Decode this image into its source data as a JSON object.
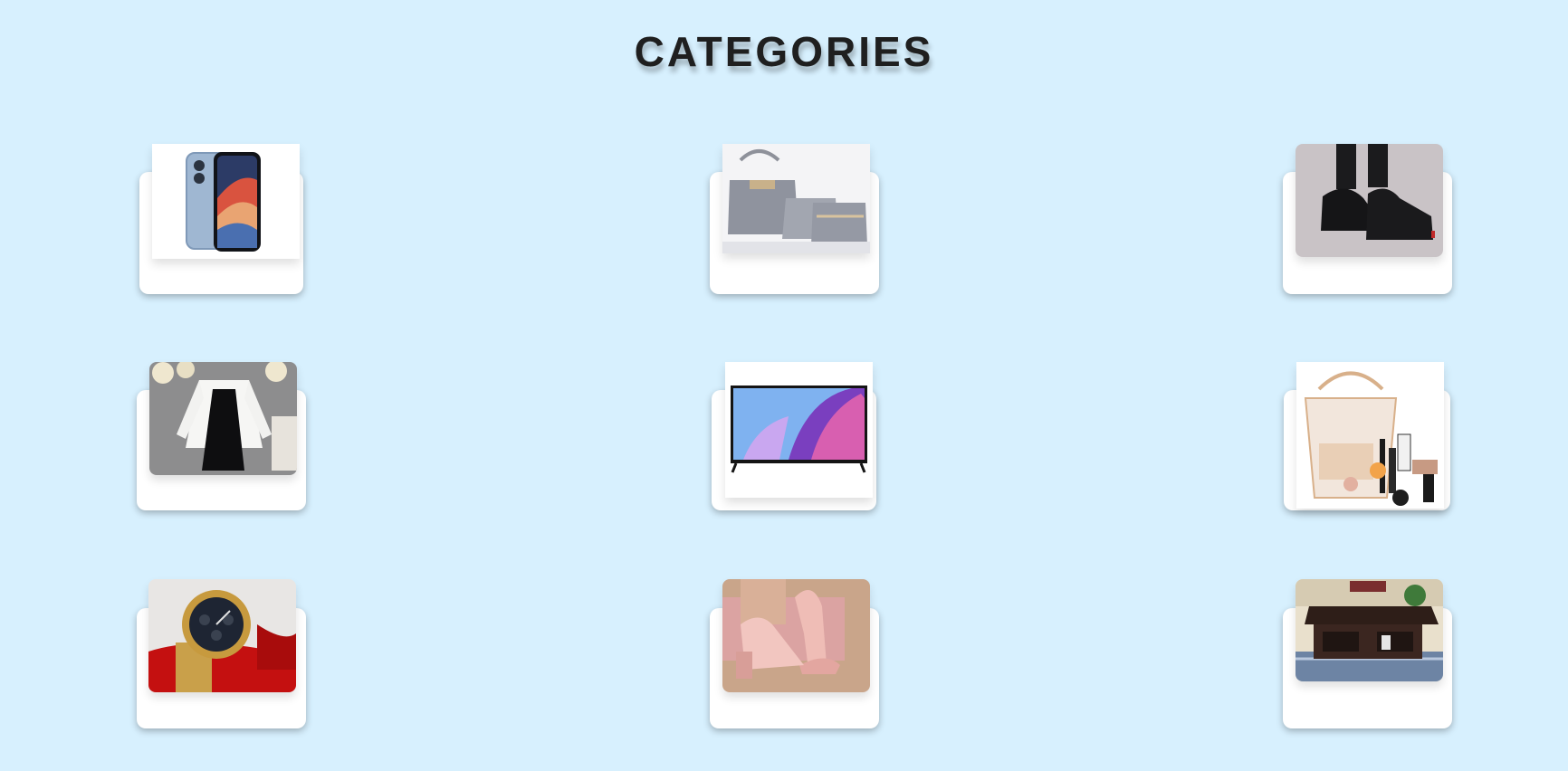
{
  "page": {
    "title": "CATEGORIES"
  },
  "categories": [
    {
      "icon": "smartphone-icon"
    },
    {
      "icon": "handbag-set-icon"
    },
    {
      "icon": "sneakers-icon"
    },
    {
      "icon": "womens-dress-icon"
    },
    {
      "icon": "television-icon"
    },
    {
      "icon": "makeup-kit-icon"
    },
    {
      "icon": "wristwatch-icon"
    },
    {
      "icon": "sandals-icon"
    },
    {
      "icon": "coffee-table-icon"
    }
  ]
}
